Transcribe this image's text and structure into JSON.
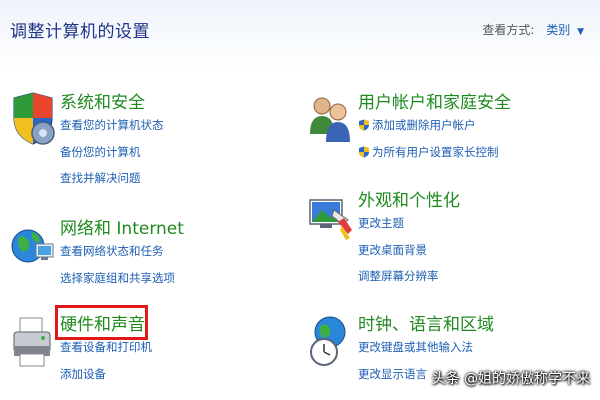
{
  "header": {
    "title": "调整计算机的设置",
    "view_by_label": "查看方式:",
    "view_by_value": "类别"
  },
  "categories": {
    "system_security": {
      "title": "系统和安全",
      "links": [
        "查看您的计算机状态",
        "备份您的计算机",
        "查找并解决问题"
      ]
    },
    "network": {
      "title": "网络和 Internet",
      "links": [
        "查看网络状态和任务",
        "选择家庭组和共享选项"
      ]
    },
    "hardware_sound": {
      "title": "硬件和声音",
      "links": [
        "查看设备和打印机",
        "添加设备"
      ]
    },
    "user_accounts": {
      "title": "用户帐户和家庭安全",
      "links": [
        "添加或删除用户帐户",
        "为所有用户设置家长控制"
      ]
    },
    "appearance": {
      "title": "外观和个性化",
      "links": [
        "更改主题",
        "更改桌面背景",
        "调整屏幕分辨率"
      ]
    },
    "clock_region": {
      "title": "时钟、语言和区域",
      "links": [
        "更改键盘或其他输入法",
        "更改显示语言"
      ]
    }
  },
  "watermark": "头条 @姐的娇傲称学不来",
  "colors": {
    "title_blue": "#1e3287",
    "category_green": "#1f8a1f",
    "link_blue": "#1e5fb4",
    "highlight_red": "#e01818"
  }
}
